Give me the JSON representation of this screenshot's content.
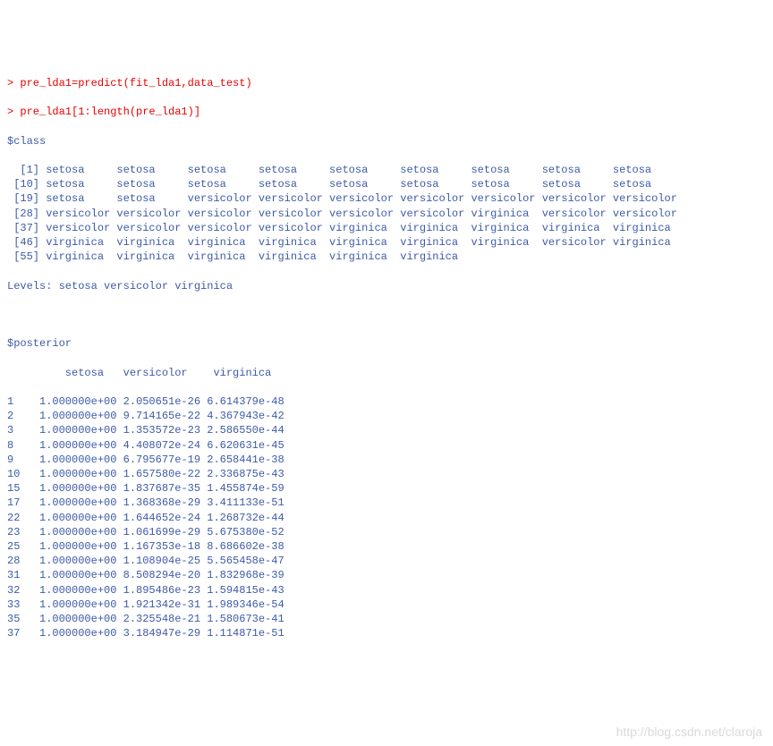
{
  "commands": [
    "> pre_lda1=predict(fit_lda1,data_test)",
    "> pre_lda1[1:length(pre_lda1)]"
  ],
  "class_header": "$class",
  "class_rows": [
    {
      "idx": "[1]",
      "vals": [
        "setosa",
        "setosa",
        "setosa",
        "setosa",
        "setosa",
        "setosa",
        "setosa",
        "setosa",
        "setosa"
      ]
    },
    {
      "idx": "[10]",
      "vals": [
        "setosa",
        "setosa",
        "setosa",
        "setosa",
        "setosa",
        "setosa",
        "setosa",
        "setosa",
        "setosa"
      ]
    },
    {
      "idx": "[19]",
      "vals": [
        "setosa",
        "setosa",
        "versicolor",
        "versicolor",
        "versicolor",
        "versicolor",
        "versicolor",
        "versicolor",
        "versicolor"
      ]
    },
    {
      "idx": "[28]",
      "vals": [
        "versicolor",
        "versicolor",
        "versicolor",
        "versicolor",
        "versicolor",
        "versicolor",
        "virginica",
        "versicolor",
        "versicolor"
      ]
    },
    {
      "idx": "[37]",
      "vals": [
        "versicolor",
        "versicolor",
        "versicolor",
        "versicolor",
        "virginica",
        "virginica",
        "virginica",
        "virginica",
        "virginica"
      ]
    },
    {
      "idx": "[46]",
      "vals": [
        "virginica",
        "virginica",
        "virginica",
        "virginica",
        "virginica",
        "virginica",
        "virginica",
        "versicolor",
        "virginica"
      ]
    },
    {
      "idx": "[55]",
      "vals": [
        "virginica",
        "virginica",
        "virginica",
        "virginica",
        "virginica",
        "virginica"
      ]
    }
  ],
  "levels_line": "Levels: setosa versicolor virginica",
  "posterior_header": "$posterior",
  "posterior_col_header": "         setosa   versicolor    virginica",
  "posterior_rows": [
    {
      "n": "1",
      "setosa": "1.000000e+00",
      "versicolor": "2.050651e-26",
      "virginica": "6.614379e-48"
    },
    {
      "n": "2",
      "setosa": "1.000000e+00",
      "versicolor": "9.714165e-22",
      "virginica": "4.367943e-42"
    },
    {
      "n": "3",
      "setosa": "1.000000e+00",
      "versicolor": "1.353572e-23",
      "virginica": "2.586550e-44"
    },
    {
      "n": "8",
      "setosa": "1.000000e+00",
      "versicolor": "4.408072e-24",
      "virginica": "6.620631e-45"
    },
    {
      "n": "9",
      "setosa": "1.000000e+00",
      "versicolor": "6.795677e-19",
      "virginica": "2.658441e-38"
    },
    {
      "n": "10",
      "setosa": "1.000000e+00",
      "versicolor": "1.657580e-22",
      "virginica": "2.336875e-43"
    },
    {
      "n": "15",
      "setosa": "1.000000e+00",
      "versicolor": "1.837687e-35",
      "virginica": "1.455874e-59"
    },
    {
      "n": "17",
      "setosa": "1.000000e+00",
      "versicolor": "1.368368e-29",
      "virginica": "3.411133e-51"
    },
    {
      "n": "22",
      "setosa": "1.000000e+00",
      "versicolor": "1.644652e-24",
      "virginica": "1.268732e-44"
    },
    {
      "n": "23",
      "setosa": "1.000000e+00",
      "versicolor": "1.061699e-29",
      "virginica": "5.675380e-52"
    },
    {
      "n": "25",
      "setosa": "1.000000e+00",
      "versicolor": "1.167353e-18",
      "virginica": "8.686602e-38"
    },
    {
      "n": "28",
      "setosa": "1.000000e+00",
      "versicolor": "1.108904e-25",
      "virginica": "5.565458e-47"
    },
    {
      "n": "31",
      "setosa": "1.000000e+00",
      "versicolor": "8.508294e-20",
      "virginica": "1.832968e-39"
    },
    {
      "n": "32",
      "setosa": "1.000000e+00",
      "versicolor": "1.895486e-23",
      "virginica": "1.594815e-43"
    },
    {
      "n": "33",
      "setosa": "1.000000e+00",
      "versicolor": "1.921342e-31",
      "virginica": "1.989346e-54"
    },
    {
      "n": "35",
      "setosa": "1.000000e+00",
      "versicolor": "2.325548e-21",
      "virginica": "1.580673e-41"
    },
    {
      "n": "37",
      "setosa": "1.000000e+00",
      "versicolor": "3.184947e-29",
      "virginica": "1.114871e-51"
    }
  ],
  "watermark": "http://blog.csdn.net/claroja"
}
